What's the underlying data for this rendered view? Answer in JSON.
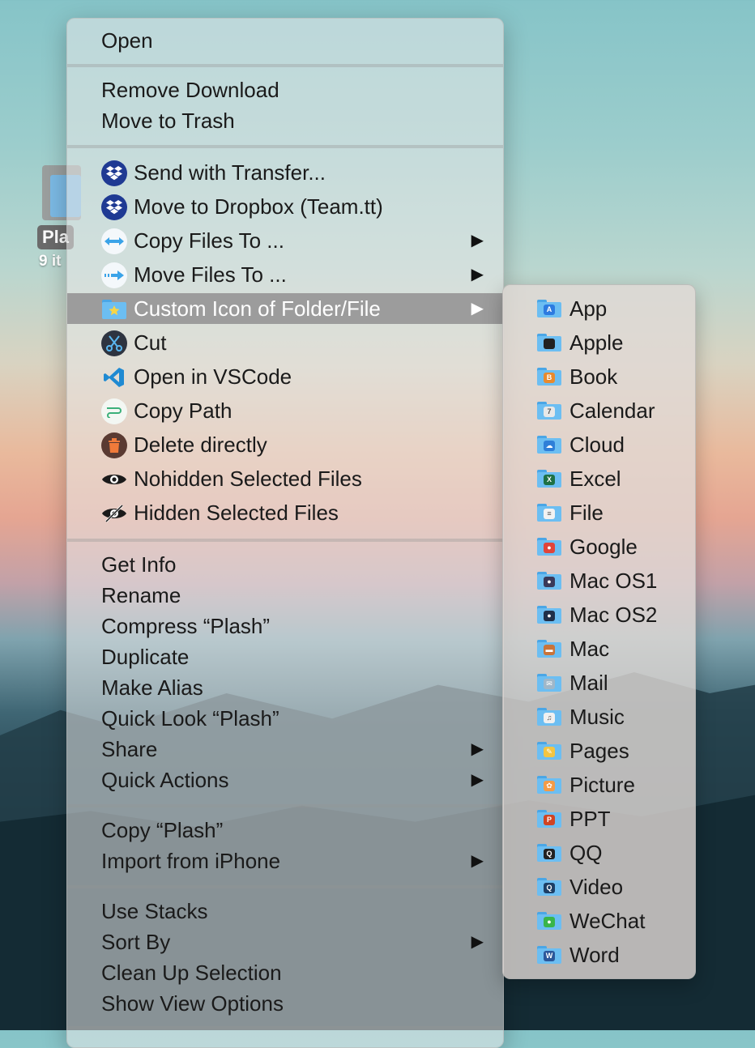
{
  "desktop": {
    "label": "Pla",
    "sub": "9 it"
  },
  "menu": {
    "group1": [
      "Open"
    ],
    "group2": [
      "Remove Download",
      "Move to Trash"
    ],
    "group3": [
      {
        "label": "Send with Transfer...",
        "icon": "dropbox-icon"
      },
      {
        "label": "Move to Dropbox (Team.tt)",
        "icon": "dropbox-icon"
      },
      {
        "label": "Copy Files To ...",
        "icon": "copy-arrows-icon",
        "arrow": "▶"
      },
      {
        "label": "Move Files To ...",
        "icon": "move-arrow-icon",
        "arrow": "▶"
      },
      {
        "label": "Custom Icon of Folder/File",
        "icon": "star-folder-icon",
        "arrow": "▶"
      },
      {
        "label": "Cut",
        "icon": "scissors-icon"
      },
      {
        "label": "Open in VSCode",
        "icon": "vscode-icon"
      },
      {
        "label": "Copy Path",
        "icon": "path-icon"
      },
      {
        "label": "Delete directly",
        "icon": "trash-icon"
      },
      {
        "label": "Nohidden Selected Files",
        "icon": "eye-icon"
      },
      {
        "label": "Hidden Selected Files",
        "icon": "eye-slash-icon"
      }
    ],
    "group4": [
      {
        "label": "Get Info"
      },
      {
        "label": "Rename"
      },
      {
        "label": "Compress “Plash”"
      },
      {
        "label": "Duplicate"
      },
      {
        "label": "Make Alias"
      },
      {
        "label": "Quick Look “Plash”"
      },
      {
        "label": "Share",
        "arrow": "▶"
      },
      {
        "label": "Quick Actions",
        "arrow": "▶"
      }
    ],
    "group5": [
      {
        "label": "Copy “Plash”"
      },
      {
        "label": "Import from iPhone",
        "arrow": "▶"
      }
    ],
    "group6": [
      {
        "label": "Use Stacks"
      },
      {
        "label": "Sort By",
        "arrow": "▶"
      },
      {
        "label": "Clean Up Selection"
      },
      {
        "label": "Show View Options"
      }
    ]
  },
  "submenu": {
    "items": [
      {
        "label": "App",
        "icon": "app-store-icon",
        "color": "#2d7be0"
      },
      {
        "label": "Apple",
        "icon": "apple-icon",
        "color": "#222222"
      },
      {
        "label": "Book",
        "icon": "book-icon",
        "color": "#e98a2d"
      },
      {
        "label": "Calendar",
        "icon": "calendar-icon",
        "color": "#e8e8e8"
      },
      {
        "label": "Cloud",
        "icon": "cloud-icon",
        "color": "#2f7fd8"
      },
      {
        "label": "Excel",
        "icon": "excel-icon",
        "color": "#1e7145"
      },
      {
        "label": "File",
        "icon": "file-icon",
        "color": "#f2f2f2"
      },
      {
        "label": "Google",
        "icon": "chrome-icon",
        "color": "#e0443a"
      },
      {
        "label": "Mac OS1",
        "icon": "macos-icon",
        "color": "#3a3a5a"
      },
      {
        "label": "Mac OS2",
        "icon": "macos-icon",
        "color": "#20304a"
      },
      {
        "label": "Mac",
        "icon": "mac-icon",
        "color": "#c9743a"
      },
      {
        "label": "Mail",
        "icon": "mail-icon",
        "color": "#9fb7c9"
      },
      {
        "label": "Music",
        "icon": "music-icon",
        "color": "#f0f0f0"
      },
      {
        "label": "Pages",
        "icon": "pages-icon",
        "color": "#f4c542"
      },
      {
        "label": "Picture",
        "icon": "photos-icon",
        "color": "#f29b48"
      },
      {
        "label": "PPT",
        "icon": "powerpoint-icon",
        "color": "#d04423"
      },
      {
        "label": "QQ",
        "icon": "qq-icon",
        "color": "#222222"
      },
      {
        "label": "Video",
        "icon": "quicktime-icon",
        "color": "#1d3f66"
      },
      {
        "label": "WeChat",
        "icon": "wechat-icon",
        "color": "#39b54a"
      },
      {
        "label": "Word",
        "icon": "word-icon",
        "color": "#2b579a"
      }
    ]
  }
}
